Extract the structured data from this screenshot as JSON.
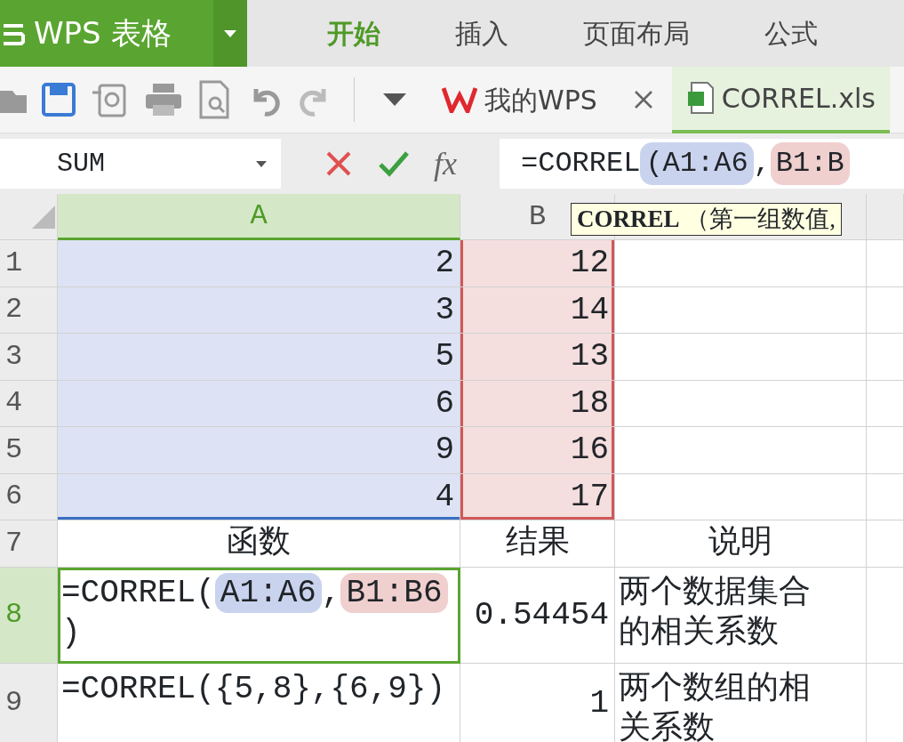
{
  "app": {
    "title": "WPS 表格"
  },
  "ribbon_tabs": [
    {
      "label": "开始",
      "selected": true
    },
    {
      "label": "插入",
      "selected": false
    },
    {
      "label": "页面布局",
      "selected": false
    },
    {
      "label": "公式",
      "selected": false
    }
  ],
  "doc_tabs": [
    {
      "label": "我的WPS",
      "selected": false,
      "kind": "home"
    },
    {
      "label": "CORREL.xls",
      "selected": true,
      "kind": "sheet"
    }
  ],
  "name_box": {
    "value": "SUM"
  },
  "function_button": {
    "label": "fx"
  },
  "formula": {
    "parts": [
      {
        "text": "=CORREL"
      },
      {
        "text": "(A1:A6",
        "color": "#c9d3ee"
      },
      {
        "text": ","
      },
      {
        "text": "B1:B",
        "color": "#f0cfcf"
      }
    ]
  },
  "tooltip": {
    "text": "**CORREL** （第一组数值,"
  },
  "columns": [
    {
      "label": "A",
      "selected": true
    },
    {
      "label": "B",
      "selected": false
    },
    {
      "selected": false
    },
    {
      "selected": false
    }
  ],
  "rows": [
    {
      "header": "1",
      "selected": false,
      "cells": [
        {
          "kind": "number",
          "text": "2",
          "color": "#dde3f4"
        },
        {
          "kind": "number",
          "text": "12",
          "color": "#f4dede"
        }
      ]
    },
    {
      "header": "2",
      "selected": false,
      "cells": [
        {
          "kind": "number",
          "text": "3",
          "color": "#dde3f4"
        },
        {
          "kind": "number",
          "text": "14",
          "color": "#f4dede"
        }
      ]
    },
    {
      "header": "3",
      "selected": false,
      "cells": [
        {
          "kind": "number",
          "text": "5",
          "color": "#dde3f4"
        },
        {
          "kind": "number",
          "text": "13",
          "color": "#f4dede"
        }
      ]
    },
    {
      "header": "4",
      "selected": false,
      "cells": [
        {
          "kind": "number",
          "text": "6",
          "color": "#dde3f4"
        },
        {
          "kind": "number",
          "text": "18",
          "color": "#f4dede"
        }
      ]
    },
    {
      "header": "5",
      "selected": false,
      "cells": [
        {
          "kind": "number",
          "text": "9",
          "color": "#dde3f4"
        },
        {
          "kind": "number",
          "text": "16",
          "color": "#f4dede"
        }
      ]
    },
    {
      "header": "6",
      "selected": false,
      "cells": [
        {
          "kind": "number",
          "text": "4",
          "color": "#dde3f4"
        },
        {
          "kind": "number",
          "text": "17",
          "color": "#f4dede"
        }
      ]
    },
    {
      "header": "7",
      "selected": false,
      "cells": [
        {
          "kind": "heading",
          "text": "函数"
        },
        {
          "kind": "heading",
          "text": "结果"
        },
        {
          "kind": "heading",
          "text": "说明"
        }
      ]
    },
    {
      "header": "8",
      "selected": true,
      "cells": [
        {
          "kind": "text",
          "active": true,
          "parts": [
            {
              "text": "=CORREL("
            },
            {
              "text": "A1:A6",
              "color": "#c9d3ee"
            },
            {
              "text": ","
            },
            {
              "text": "B1:B6",
              "color": "#f0cfcf"
            },
            {
              "text": ")"
            }
          ]
        },
        {
          "kind": "number",
          "text": "0.54454"
        },
        {
          "kind": "text",
          "text": "两个数据集合的相关系数"
        }
      ]
    },
    {
      "header": "9",
      "selected": false,
      "cells": [
        {
          "kind": "text",
          "text": "=CORREL({5,8},{6,9})"
        },
        {
          "kind": "number",
          "text": "1"
        },
        {
          "kind": "text",
          "text": "两个数组的相关系数"
        }
      ]
    }
  ]
}
